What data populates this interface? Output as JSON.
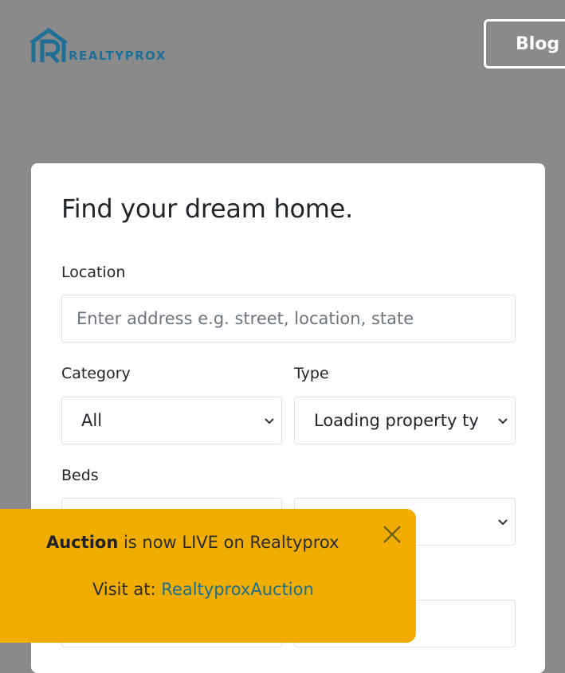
{
  "brand": {
    "name": "REALTYPROX",
    "color": "#1f6f96"
  },
  "nav": {
    "blog_label": "Blog"
  },
  "search_card": {
    "title": "Find your dream home.",
    "location": {
      "label": "Location",
      "placeholder": "Enter address e.g. street, location, state"
    },
    "category": {
      "label": "Category",
      "selected": "All"
    },
    "type": {
      "label": "Type",
      "selected": "Loading property types..."
    },
    "beds": {
      "label": "Beds"
    }
  },
  "toast": {
    "bold": "Auction",
    "message": " is now LIVE on Realtyprox",
    "visit_prefix": "Visit at: ",
    "link_text": "RealtyproxAuction",
    "background": "#f0ad00"
  }
}
